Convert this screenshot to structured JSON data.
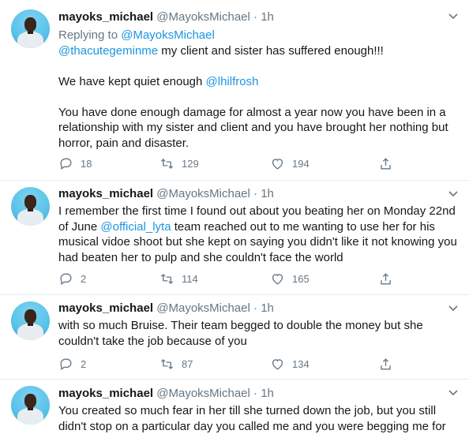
{
  "author": {
    "name": "mayoks_michael",
    "handle": "@MayoksMichael",
    "time": "1h"
  },
  "tweets": [
    {
      "reply_prefix": "Replying to ",
      "reply_to": "@MayoksMichael",
      "mention_1": "@thacutegeminme",
      "line_1": " my client and sister has suffered enough!!!",
      "para_2": "We have kept quiet enough ",
      "mention_2": "@lhilfrosh",
      "para_3": "You have done enough damage for almost a year now you have been in a relationship with my sister and client and you have brought her nothing but horror, pain and disaster.",
      "replies": "18",
      "retweets": "129",
      "likes": "194"
    },
    {
      "text_a": "I remember the first time I found out about you beating her on Monday 22nd of June ",
      "mention": "@official_lyta",
      "text_b": " team reached out to me wanting to use her for his musical vidoe shoot but she kept on saying you didn't like it not knowing you had beaten her to pulp and she couldn't face the world",
      "replies": "2",
      "retweets": "114",
      "likes": "165"
    },
    {
      "text": "with so much Bruise. Their team begged to double the money but she couldn't take the job because of you",
      "replies": "2",
      "retweets": "87",
      "likes": "134"
    },
    {
      "text": "You created so much fear in her till she turned down the job, but you still didn't stop on a particular day you called me and you were begging me for"
    }
  ],
  "icons": {
    "reply": "reply-icon",
    "retweet": "retweet-icon",
    "like": "heart-icon",
    "share": "share-icon",
    "more": "chevron-down-icon"
  },
  "colors": {
    "link": "#1b95e0",
    "muted": "#657786",
    "divider": "#e6ecf0"
  }
}
